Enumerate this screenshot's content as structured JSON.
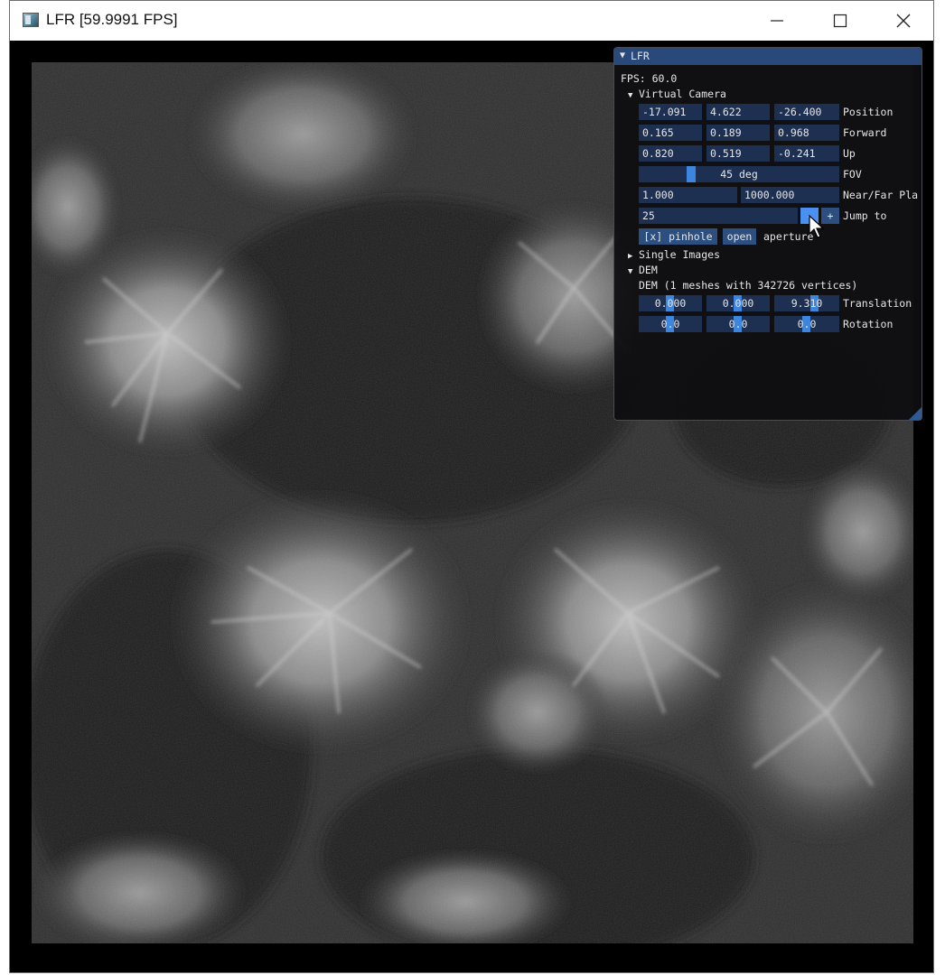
{
  "window": {
    "title": "LFR [59.9991 FPS]"
  },
  "panel": {
    "title": "LFR",
    "fps": "FPS: 60.0",
    "virtual_camera": {
      "header": "Virtual Camera",
      "position": {
        "values": [
          "-17.091",
          "4.622",
          "-26.400"
        ],
        "label": "Position"
      },
      "forward": {
        "values": [
          "0.165",
          "0.189",
          "0.968"
        ],
        "label": "Forward"
      },
      "up": {
        "values": [
          "0.820",
          "0.519",
          "-0.241"
        ],
        "label": "Up"
      },
      "fov": {
        "value": "45 deg",
        "label": "FOV",
        "level": 0.25
      },
      "near_far": {
        "values": [
          "1.000",
          "1000.000"
        ],
        "label": "Near/Far Pla"
      },
      "jump_to": {
        "value": "25",
        "minus": "-",
        "plus": "+",
        "label": "Jump to"
      },
      "pinhole_button": "[x] pinhole",
      "open_button": "open",
      "aperture_label": "aperture"
    },
    "single_images": {
      "header": "Single Images"
    },
    "dem": {
      "header": "DEM",
      "info": "DEM (1 meshes with 342726 vertices)",
      "translation": {
        "values": [
          "0.000",
          "0.000",
          "9.310"
        ],
        "label": "Translation"
      },
      "rotation": {
        "values": [
          "0.0",
          "0.0",
          "0.0"
        ],
        "label": "Rotation"
      }
    }
  },
  "colors": {
    "title_bar_active": "#29497a",
    "frame_bg": "#1e3052",
    "slider_grab": "#3d86e0",
    "button": "#2d4f80"
  }
}
